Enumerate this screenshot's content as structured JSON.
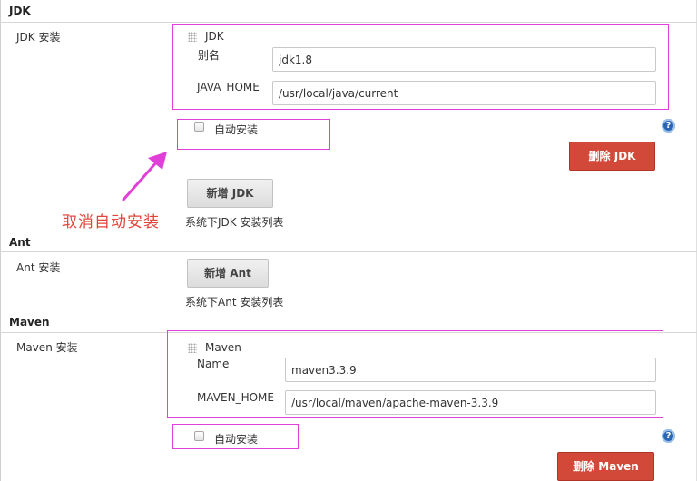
{
  "jdk": {
    "section_title": "JDK",
    "row_label": "JDK 安装",
    "installation": {
      "header": "JDK",
      "alias_label": "别名",
      "alias_value": "jdk1.8",
      "home_label": "JAVA_HOME",
      "home_value": "/usr/local/java/current",
      "auto_install_label": "自动安装",
      "auto_install_checked": false
    },
    "delete_button": "删除 JDK",
    "add_button": "新增 JDK",
    "list_hint": "系统下JDK 安装列表"
  },
  "annotation": {
    "text": "取消自动安装",
    "color": "#e0453a",
    "arrow_color": "#e040d8"
  },
  "ant": {
    "section_title": "Ant",
    "row_label": "Ant 安装",
    "add_button": "新增 Ant",
    "list_hint": "系统下Ant 安装列表"
  },
  "maven": {
    "section_title": "Maven",
    "row_label": "Maven 安装",
    "installation": {
      "header": "Maven",
      "name_label": "Name",
      "name_value": "maven3.3.9",
      "home_label": "MAVEN_HOME",
      "home_value": "/usr/local/maven/apache-maven-3.3.9",
      "auto_install_label": "自动安装",
      "auto_install_checked": false
    },
    "delete_button": "删除 Maven"
  },
  "help_icon_glyph": "?",
  "colors": {
    "delete_button": "#d24939",
    "highlight_box": "#e040d8",
    "help_icon": "#2a66b3"
  }
}
